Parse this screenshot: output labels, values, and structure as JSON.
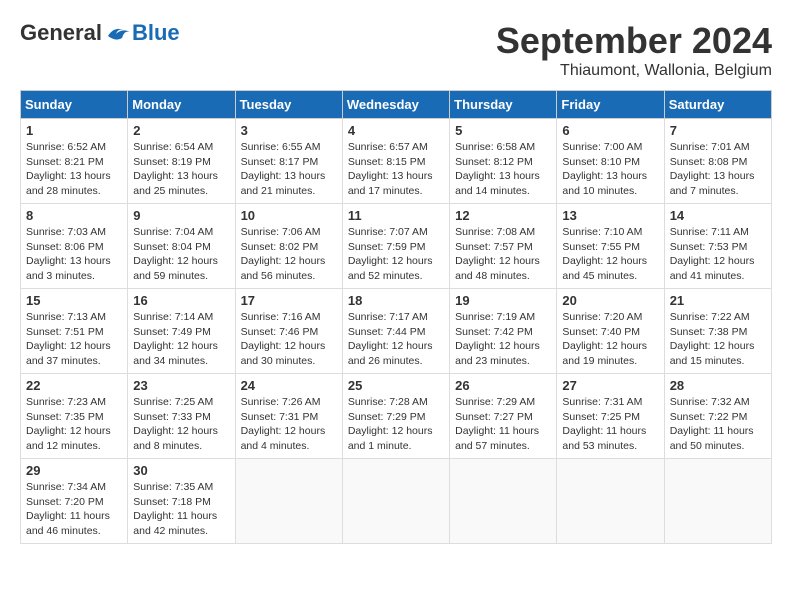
{
  "logo": {
    "general": "General",
    "blue": "Blue"
  },
  "title": "September 2024",
  "location": "Thiaumont, Wallonia, Belgium",
  "days_of_week": [
    "Sunday",
    "Monday",
    "Tuesday",
    "Wednesday",
    "Thursday",
    "Friday",
    "Saturday"
  ],
  "weeks": [
    [
      {
        "day": "1",
        "sunrise": "6:52 AM",
        "sunset": "8:21 PM",
        "daylight": "13 hours and 28 minutes."
      },
      {
        "day": "2",
        "sunrise": "6:54 AM",
        "sunset": "8:19 PM",
        "daylight": "13 hours and 25 minutes."
      },
      {
        "day": "3",
        "sunrise": "6:55 AM",
        "sunset": "8:17 PM",
        "daylight": "13 hours and 21 minutes."
      },
      {
        "day": "4",
        "sunrise": "6:57 AM",
        "sunset": "8:15 PM",
        "daylight": "13 hours and 17 minutes."
      },
      {
        "day": "5",
        "sunrise": "6:58 AM",
        "sunset": "8:12 PM",
        "daylight": "13 hours and 14 minutes."
      },
      {
        "day": "6",
        "sunrise": "7:00 AM",
        "sunset": "8:10 PM",
        "daylight": "13 hours and 10 minutes."
      },
      {
        "day": "7",
        "sunrise": "7:01 AM",
        "sunset": "8:08 PM",
        "daylight": "13 hours and 7 minutes."
      }
    ],
    [
      {
        "day": "8",
        "sunrise": "7:03 AM",
        "sunset": "8:06 PM",
        "daylight": "13 hours and 3 minutes."
      },
      {
        "day": "9",
        "sunrise": "7:04 AM",
        "sunset": "8:04 PM",
        "daylight": "12 hours and 59 minutes."
      },
      {
        "day": "10",
        "sunrise": "7:06 AM",
        "sunset": "8:02 PM",
        "daylight": "12 hours and 56 minutes."
      },
      {
        "day": "11",
        "sunrise": "7:07 AM",
        "sunset": "7:59 PM",
        "daylight": "12 hours and 52 minutes."
      },
      {
        "day": "12",
        "sunrise": "7:08 AM",
        "sunset": "7:57 PM",
        "daylight": "12 hours and 48 minutes."
      },
      {
        "day": "13",
        "sunrise": "7:10 AM",
        "sunset": "7:55 PM",
        "daylight": "12 hours and 45 minutes."
      },
      {
        "day": "14",
        "sunrise": "7:11 AM",
        "sunset": "7:53 PM",
        "daylight": "12 hours and 41 minutes."
      }
    ],
    [
      {
        "day": "15",
        "sunrise": "7:13 AM",
        "sunset": "7:51 PM",
        "daylight": "12 hours and 37 minutes."
      },
      {
        "day": "16",
        "sunrise": "7:14 AM",
        "sunset": "7:49 PM",
        "daylight": "12 hours and 34 minutes."
      },
      {
        "day": "17",
        "sunrise": "7:16 AM",
        "sunset": "7:46 PM",
        "daylight": "12 hours and 30 minutes."
      },
      {
        "day": "18",
        "sunrise": "7:17 AM",
        "sunset": "7:44 PM",
        "daylight": "12 hours and 26 minutes."
      },
      {
        "day": "19",
        "sunrise": "7:19 AM",
        "sunset": "7:42 PM",
        "daylight": "12 hours and 23 minutes."
      },
      {
        "day": "20",
        "sunrise": "7:20 AM",
        "sunset": "7:40 PM",
        "daylight": "12 hours and 19 minutes."
      },
      {
        "day": "21",
        "sunrise": "7:22 AM",
        "sunset": "7:38 PM",
        "daylight": "12 hours and 15 minutes."
      }
    ],
    [
      {
        "day": "22",
        "sunrise": "7:23 AM",
        "sunset": "7:35 PM",
        "daylight": "12 hours and 12 minutes."
      },
      {
        "day": "23",
        "sunrise": "7:25 AM",
        "sunset": "7:33 PM",
        "daylight": "12 hours and 8 minutes."
      },
      {
        "day": "24",
        "sunrise": "7:26 AM",
        "sunset": "7:31 PM",
        "daylight": "12 hours and 4 minutes."
      },
      {
        "day": "25",
        "sunrise": "7:28 AM",
        "sunset": "7:29 PM",
        "daylight": "12 hours and 1 minute."
      },
      {
        "day": "26",
        "sunrise": "7:29 AM",
        "sunset": "7:27 PM",
        "daylight": "11 hours and 57 minutes."
      },
      {
        "day": "27",
        "sunrise": "7:31 AM",
        "sunset": "7:25 PM",
        "daylight": "11 hours and 53 minutes."
      },
      {
        "day": "28",
        "sunrise": "7:32 AM",
        "sunset": "7:22 PM",
        "daylight": "11 hours and 50 minutes."
      }
    ],
    [
      {
        "day": "29",
        "sunrise": "7:34 AM",
        "sunset": "7:20 PM",
        "daylight": "11 hours and 46 minutes."
      },
      {
        "day": "30",
        "sunrise": "7:35 AM",
        "sunset": "7:18 PM",
        "daylight": "11 hours and 42 minutes."
      },
      null,
      null,
      null,
      null,
      null
    ]
  ]
}
